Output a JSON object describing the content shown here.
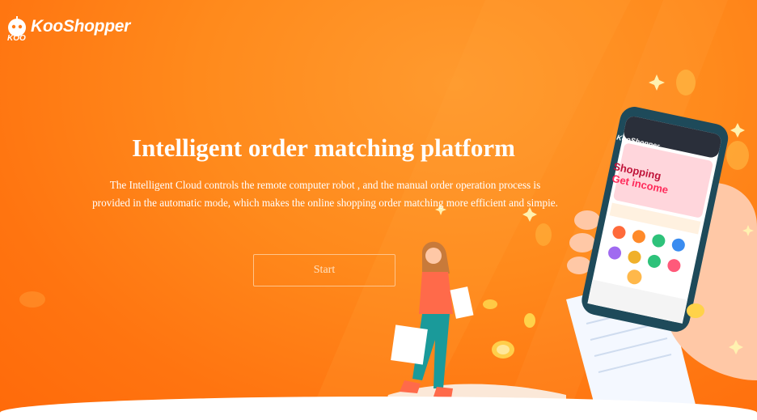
{
  "brand": {
    "name": "KooShopper",
    "mark_text": "KOO"
  },
  "hero": {
    "title": "Intelligent order matching platform",
    "description": "The Intelligent Cloud controls the remote computer robot , and the manual order operation process is provided in the automatic mode, which makes the online shopping order matching more efficient and simpie.",
    "start_label": "Start"
  },
  "phone": {
    "brand": "KooShopper",
    "banner_line1": "Shopping",
    "banner_line2": "Get income"
  },
  "colors": {
    "accent": "#ff7a14",
    "button_border": "#ffc48a"
  }
}
